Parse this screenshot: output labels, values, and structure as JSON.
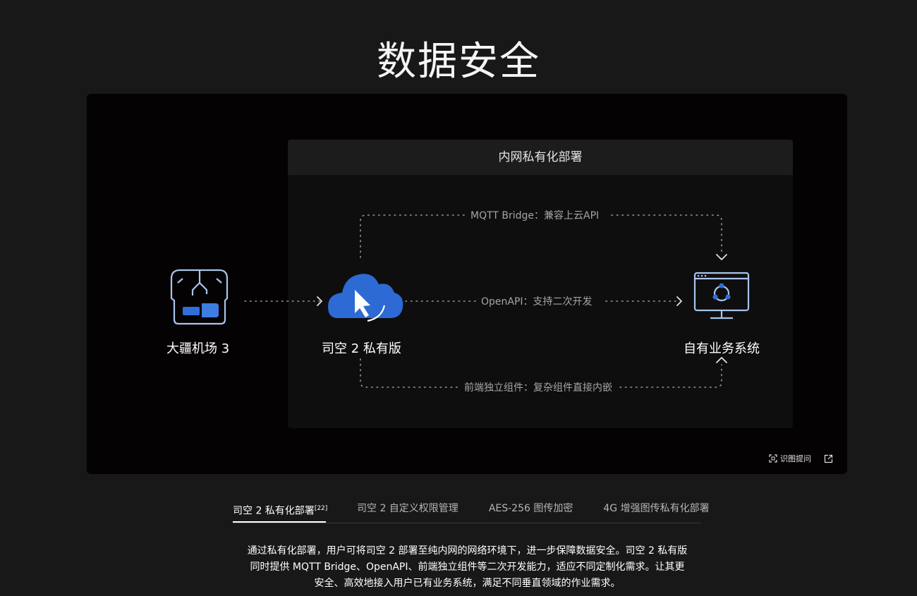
{
  "page": {
    "title": "数据安全"
  },
  "diagram": {
    "panel_title": "内网私有化部署",
    "nodes": {
      "dock": {
        "label": "大疆机场 3",
        "icon": "dock-icon"
      },
      "cloud": {
        "label": "司空 2 私有版",
        "icon": "cloud-cursor-icon"
      },
      "system": {
        "label": "自有业务系统",
        "icon": "monitor-network-icon"
      }
    },
    "connections": {
      "mqtt": "MQTT Bridge：兼容上云API",
      "openapi": "OpenAPI：支持二次开发",
      "frontend": "前端独立组件：复杂组件直接内嵌"
    },
    "colors": {
      "icon_blue": "#a9c4ee",
      "cloud_blue": "#2f6fd6",
      "dots": "#9a9a9a"
    }
  },
  "toolbar": {
    "ask_label": "识图提问",
    "ask_icon": "scan-icon",
    "share_icon": "external-link-icon"
  },
  "tabs": [
    {
      "label": "司空 2 私有化部署",
      "sup": "[22]",
      "active": true
    },
    {
      "label": "司空 2 自定义权限管理",
      "active": false
    },
    {
      "label": "AES-256 图传加密",
      "active": false
    },
    {
      "label": "4G 增强图传私有化部署",
      "active": false
    }
  ],
  "description": {
    "line1": "通过私有化部署，用户可将司空 2 部署至纯内网的网络环境下，进一步保障数据安全。司空 2 私有版",
    "line2": "同时提供 MQTT Bridge、OpenAPI、前端独立组件等二次开发能力，适应不同定制化需求。让其更",
    "line3": "安全、高效地接入用户已有业务系统，满足不同垂直领域的作业需求。"
  }
}
